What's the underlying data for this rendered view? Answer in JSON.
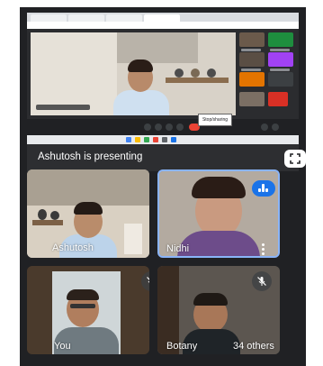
{
  "presentation": {
    "banner_text": "Ashutosh is presenting",
    "shared_tooltip": "Stop/sharing"
  },
  "tiles": [
    {
      "name": "Ashutosh"
    },
    {
      "name": "Nidhi"
    },
    {
      "name": "You"
    },
    {
      "name": "Botany"
    }
  ],
  "others": {
    "label": "34 others"
  },
  "colors": {
    "background": "#202124",
    "active_speaker_border": "#8ab4f8",
    "speaking_badge": "#1a73e8",
    "end_call": "#ea4335"
  },
  "icons": [
    "fullscreen-icon",
    "more-vert-icon",
    "mic-off-icon",
    "speaking-icon"
  ]
}
